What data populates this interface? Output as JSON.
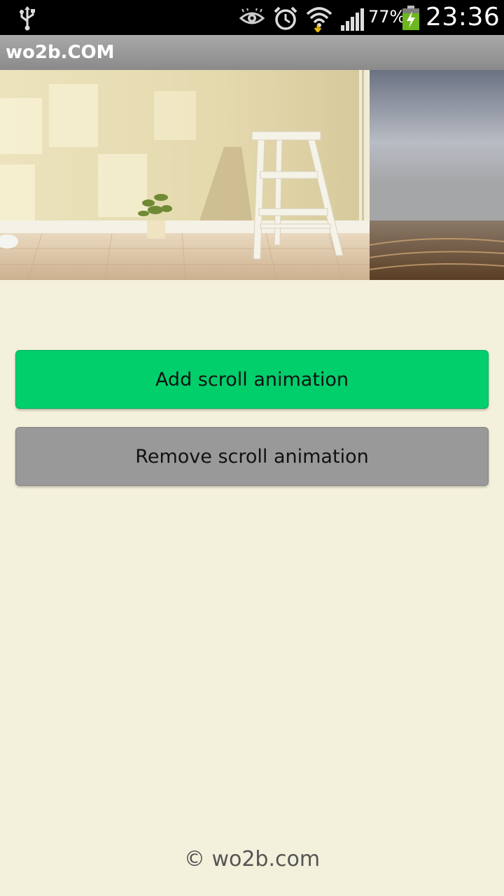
{
  "status_bar": {
    "battery_percent": "77%",
    "time": "23:36",
    "icons": [
      "usb-icon",
      "eye-icon",
      "alarm-icon",
      "wifi-icon",
      "signal-icon",
      "battery-charging-icon"
    ]
  },
  "action_bar": {
    "title": "wo2b.COM"
  },
  "slider": {
    "images": [
      "room-with-stool-image",
      "misty-field-image"
    ]
  },
  "buttons": {
    "add_label": "Add scroll animation",
    "remove_label": "Remove scroll animation"
  },
  "footer": {
    "text": "© wo2b.com"
  },
  "colors": {
    "background": "#f3f0db",
    "add_button": "#00cf6c",
    "remove_button": "#999999"
  }
}
